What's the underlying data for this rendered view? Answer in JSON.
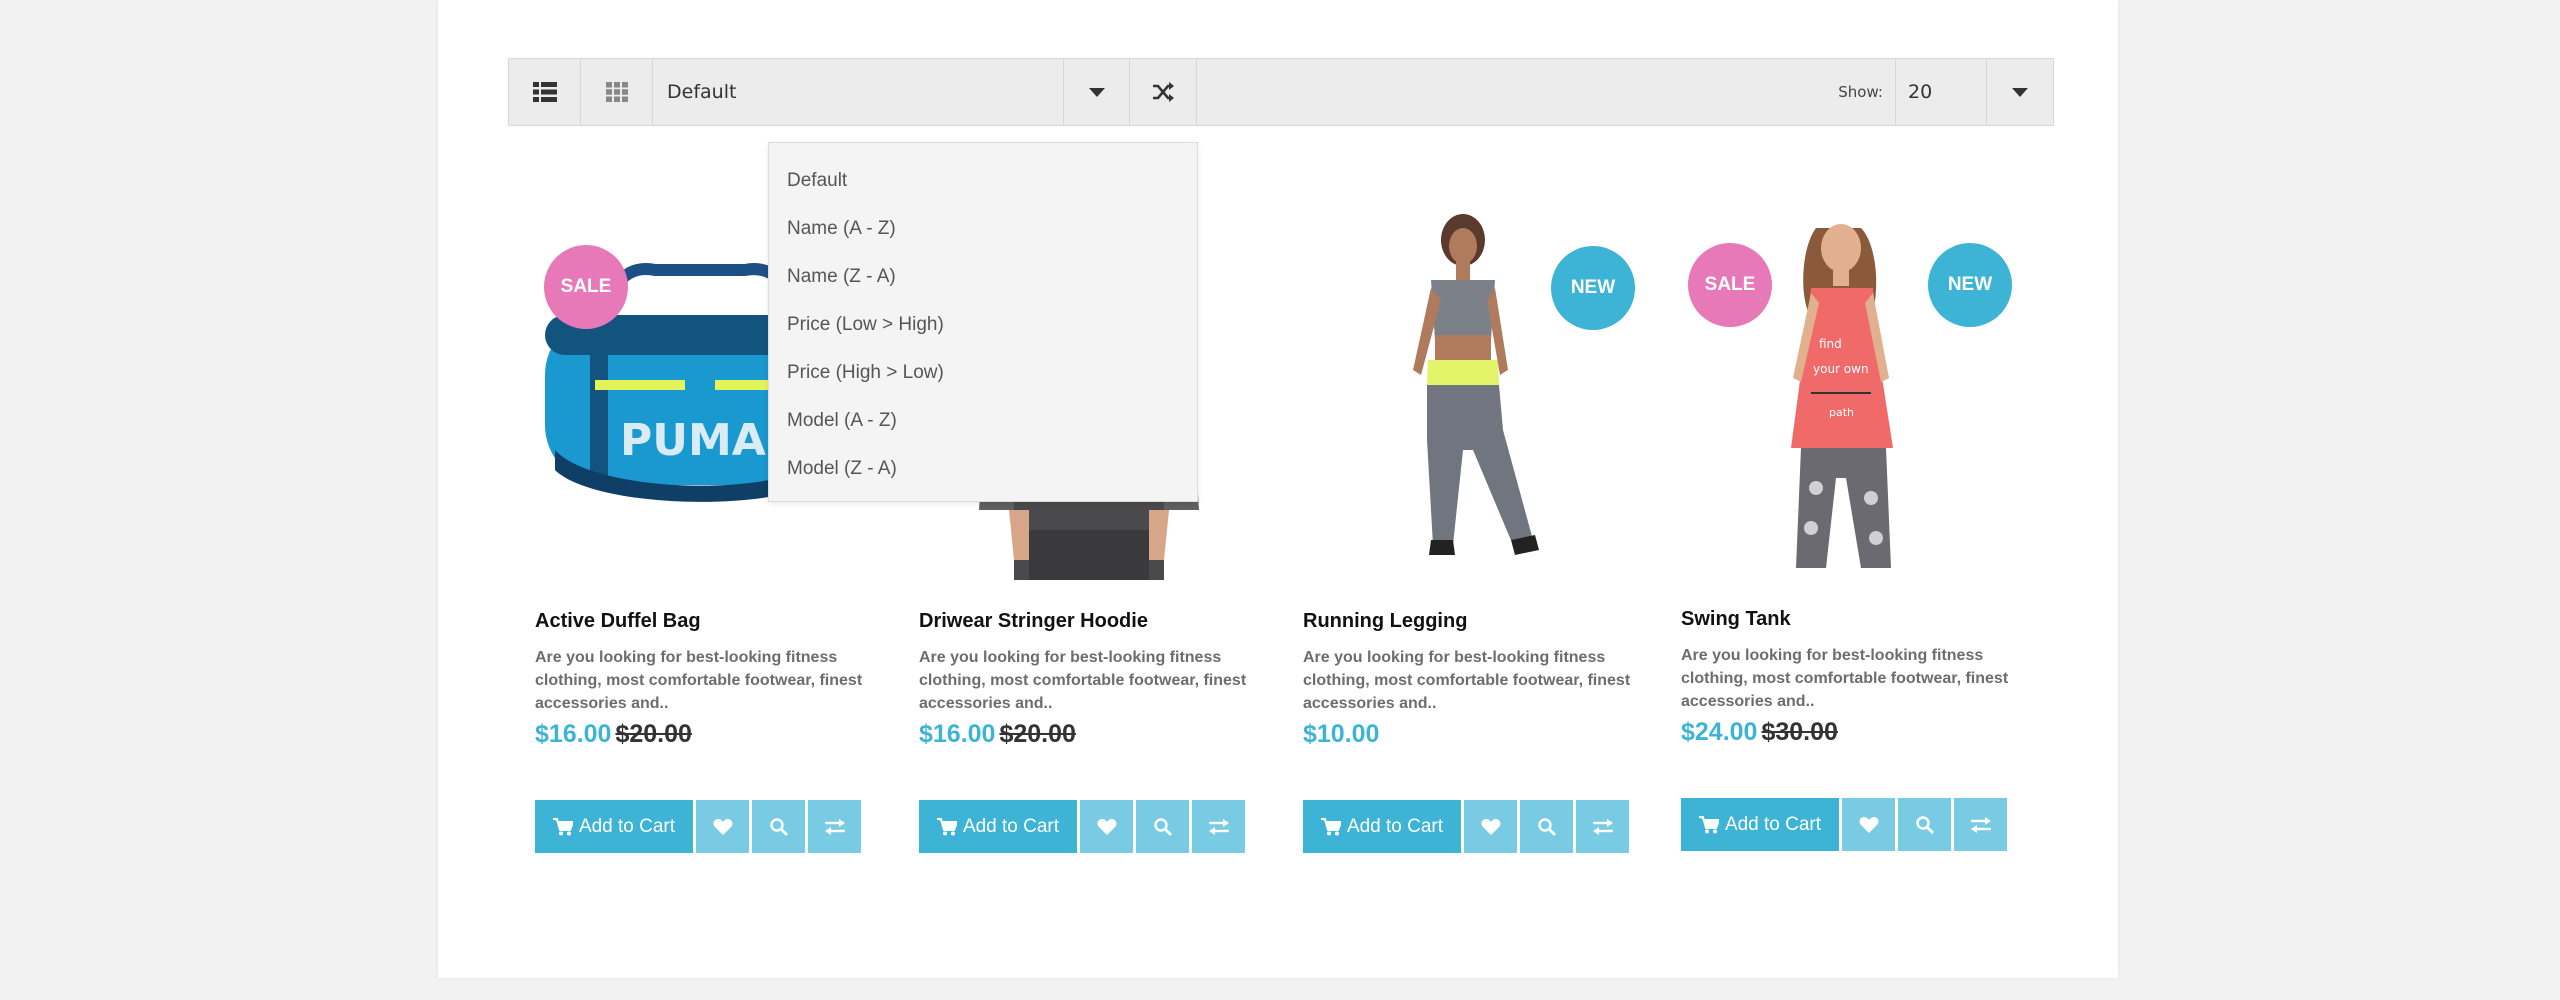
{
  "toolbar": {
    "sort_selected": "Default",
    "show_label": "Show:",
    "show_selected": "20"
  },
  "sort_options": [
    "Default",
    "Name (A - Z)",
    "Name (Z - A)",
    "Price (Low > High)",
    "Price (High > Low)",
    "Model (A - Z)",
    "Model (Z - A)"
  ],
  "products": [
    {
      "name": "Active Duffel Bag",
      "description": "Are you looking for best-looking fitness clothing, most comfortable footwear, finest accessories and..",
      "price": "$16.00",
      "old_price": "$20.00",
      "badges": [
        "SALE"
      ],
      "cart_label": "Add to Cart"
    },
    {
      "name": "Driwear Stringer Hoodie",
      "description": "Are you looking for best-looking fitness clothing, most comfortable footwear, finest accessories and..",
      "price": "$16.00",
      "old_price": "$20.00",
      "badges": [],
      "cart_label": "Add to Cart"
    },
    {
      "name": "Running Legging",
      "description": "Are you looking for best-looking fitness clothing, most comfortable footwear, finest accessories and..",
      "price": "$10.00",
      "old_price": "",
      "badges": [
        "NEW"
      ],
      "cart_label": "Add to Cart"
    },
    {
      "name": "Swing Tank",
      "description": "Are you looking for best-looking fitness clothing, most comfortable footwear, finest accessories and..",
      "price": "$24.00",
      "old_price": "$30.00",
      "badges": [
        "SALE",
        "NEW"
      ],
      "cart_label": "Add to Cart"
    }
  ],
  "colors": {
    "accent": "#3db4d6",
    "accent_light": "#79cbe4",
    "sale_badge": "#e879b9",
    "new_badge": "#3db4d6"
  },
  "icons": {
    "list_view": "list-icon",
    "grid_view": "grid-icon",
    "shuffle": "shuffle-icon",
    "cart": "cart-icon",
    "wishlist": "heart-icon",
    "quickview": "search-icon",
    "compare": "compare-icon"
  }
}
